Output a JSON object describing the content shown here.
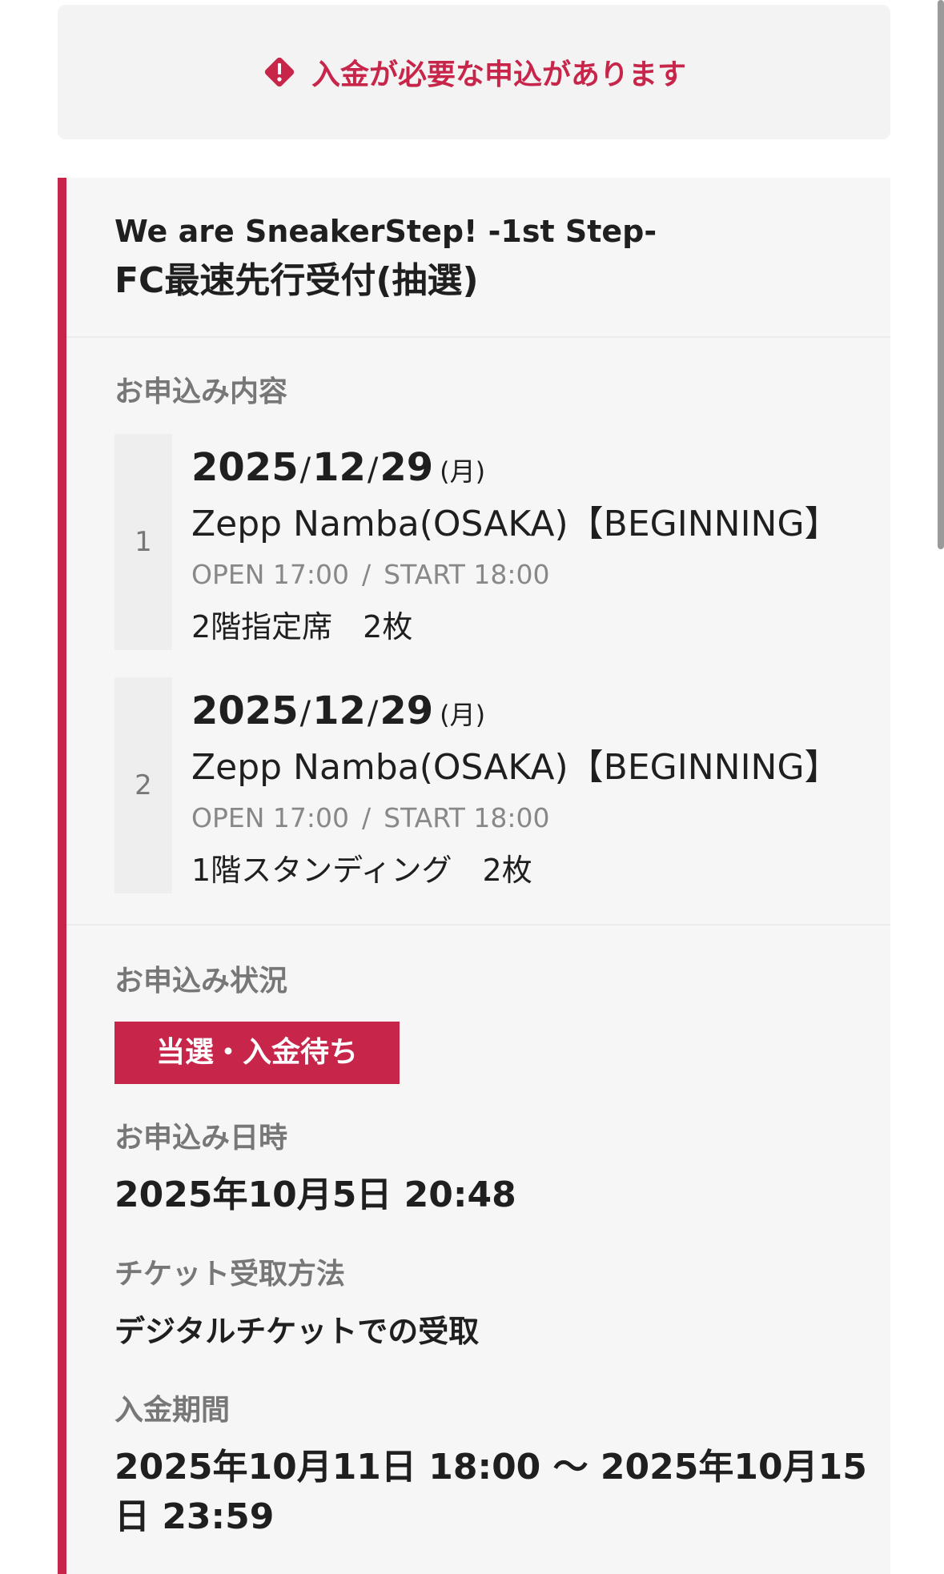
{
  "alert": {
    "message": "入金が必要な申込があります",
    "icon": "warning-icon",
    "color": "#c8254a"
  },
  "application": {
    "event_name": "We are SneakerStep! -1st Step-",
    "reception_name": "FC最速先行受付(抽選)",
    "details_label": "お申込み内容",
    "entries": [
      {
        "number": "1",
        "year": "2025",
        "month": "12",
        "day": "29",
        "weekday": "(月)",
        "venue": "Zepp Namba(OSAKA)【BEGINNING】",
        "open": "OPEN 17:00",
        "start": "START 18:00",
        "seat": "2階指定席　2枚"
      },
      {
        "number": "2",
        "year": "2025",
        "month": "12",
        "day": "29",
        "weekday": "(月)",
        "venue": "Zepp Namba(OSAKA)【BEGINNING】",
        "open": "OPEN 17:00",
        "start": "START 18:00",
        "seat": "1階スタンディング　2枚"
      }
    ],
    "status_label": "お申込み状況",
    "status": "当選・入金待ち",
    "applied_at_label": "お申込み日時",
    "applied_at": "2025年10月5日 20:48",
    "receive_method_label": "チケット受取方法",
    "receive_method": "デジタルチケットでの受取",
    "payment_period_label": "入金期間",
    "payment_period": "2025年10月11日 18:00 〜 2025年10月15日 23:59"
  },
  "theme": {
    "accent": "#c8254a",
    "card_bg": "#f6f6f6"
  }
}
